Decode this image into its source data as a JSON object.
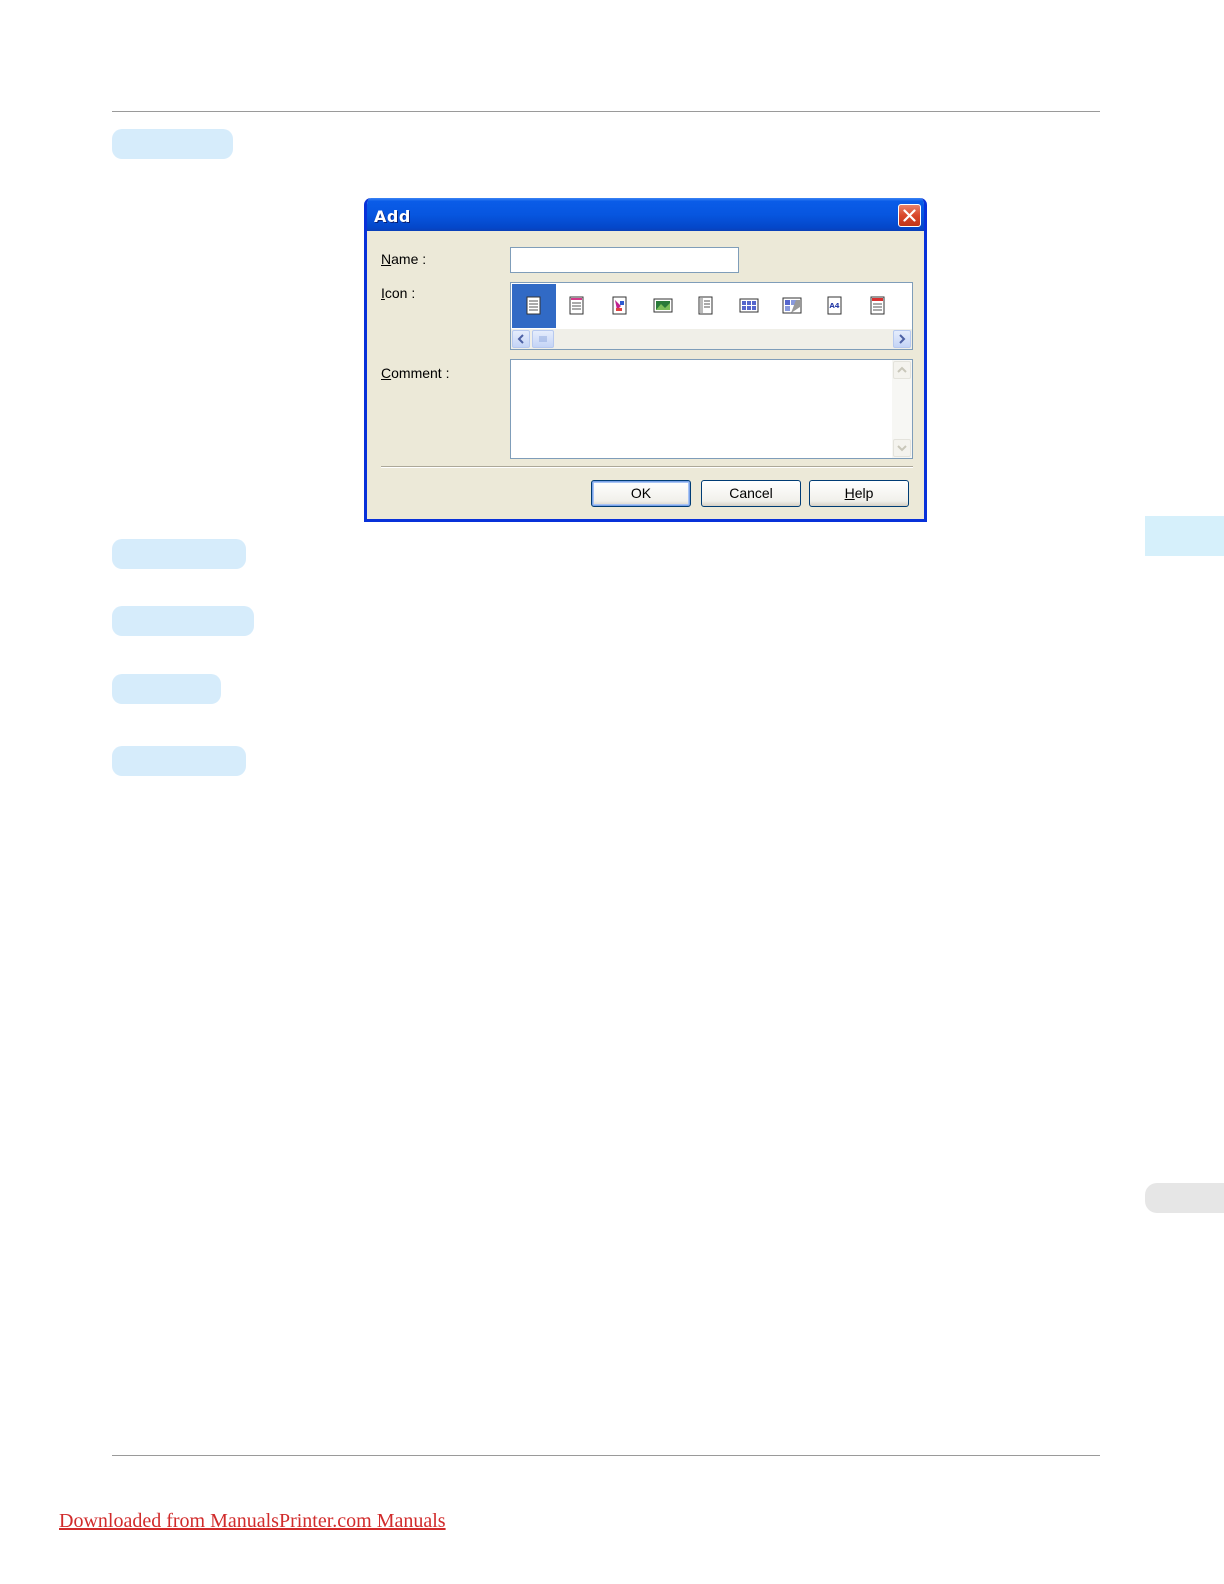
{
  "dialog": {
    "title": "Add",
    "name_label_key": "N",
    "name_label_rest": "ame :",
    "icon_label_key": "I",
    "icon_label_rest": "con :",
    "comment_label_key": "C",
    "comment_label_rest": "omment :",
    "name_value": "",
    "comment_value": "",
    "icons": [
      "page-lines-icon",
      "page-bookmark-icon",
      "page-color-icon",
      "photo-icon",
      "document-icon",
      "grid-icon",
      "poster-icon",
      "a4-paper-icon",
      "page-red-icon"
    ],
    "a4_text": "A4",
    "buttons": {
      "ok": "OK",
      "cancel": "Cancel",
      "help_key": "H",
      "help_rest": "elp"
    }
  },
  "footer": {
    "link_text": "Downloaded from ManualsPrinter.com Manuals"
  },
  "colors": {
    "highlight_pill": "#d6ecfb",
    "side_tab_blue": "#d6f0fb",
    "side_tab_gray": "#e6e6e6",
    "link": "#d12b2b",
    "selection": "#316ac5"
  }
}
